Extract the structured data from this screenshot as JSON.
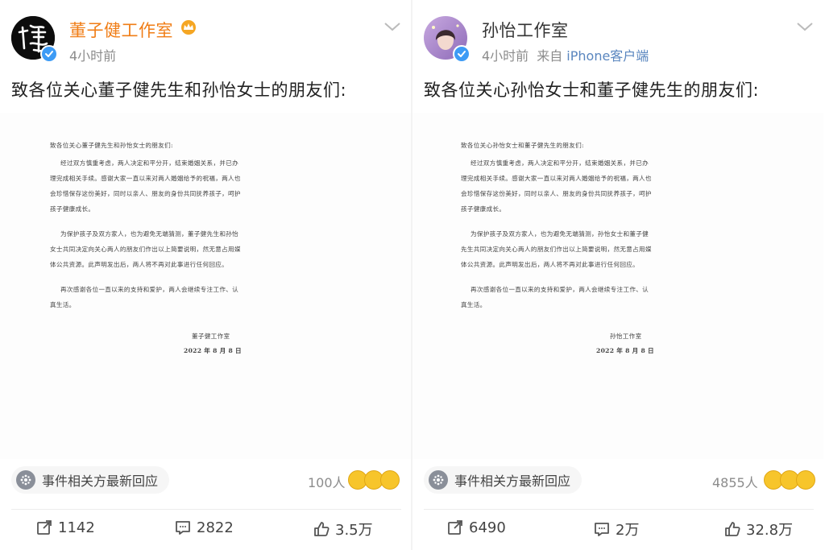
{
  "left": {
    "account_name": "董子健工作室",
    "time": "4小时前",
    "source_prefix": "",
    "source_device": "",
    "post_text": "致各位关心董子健先生和孙怡女士的朋友们:",
    "letter": {
      "greeting": "致各位关心董子健先生和孙怡女士的朋友们:",
      "p1": [
        "经过双方慎重考虑，两人决定和平分开，结束婚姻关系，并已办",
        "理完成相关手续。感谢大家一直以来对两人婚姻给予的祝福，两人也",
        "会珍惜保存这份美好，同时以亲人、朋友的身份共同抚养孩子，呵护",
        "孩子健康成长。"
      ],
      "p2": [
        "为保护孩子及双方家人，也为避免无端猜测，董子健先生和孙怡",
        "女士共同决定向关心两人的朋友们作出以上简要说明，然无意占用媒",
        "体公共资源。此声明发出后，两人将不再对此事进行任何回应。"
      ],
      "p3": [
        "再次感谢各位一直以来的支持和爱护，两人会继续专注工作、认",
        "真生活。"
      ],
      "signature": "董子健工作室",
      "date": "2022 年 8 月 8 日"
    },
    "event_label": "事件相关方最新回应",
    "reaction_count": "100人",
    "actions": {
      "repost": "1142",
      "comment": "2822",
      "like": "3.5万"
    }
  },
  "right": {
    "account_name": "孙怡工作室",
    "time": "4小时前",
    "source_prefix": "来自",
    "source_device": "iPhone客户端",
    "post_text": "致各位关心孙怡女士和董子健先生的朋友们:",
    "letter": {
      "greeting": "致各位关心孙怡女士和董子健先生的朋友们:",
      "p1": [
        "经过双方慎重考虑，两人决定和平分开，结束婚姻关系，并已办",
        "理完成相关手续。感谢大家一直以来对两人婚姻给予的祝福，两人也",
        "会珍惜保存这份美好，同时以亲人、朋友的身份共同抚养孩子，呵护",
        "孩子健康成长。"
      ],
      "p2": [
        "为保护孩子及双方家人，也为避免无端猜测，孙怡女士和董子健",
        "先生共同决定向关心两人的朋友们作出以上简要说明，然无意占用媒",
        "体公共资源。此声明发出后，两人将不再对此事进行任何回应。"
      ],
      "p3": [
        "再次感谢各位一直以来的支持和爱护，两人会继续专注工作、认",
        "真生活。"
      ],
      "signature": "孙怡工作室",
      "date": "2022 年 8 月 8 日"
    },
    "event_label": "事件相关方最新回应",
    "reaction_count": "4855人",
    "actions": {
      "repost": "6490",
      "comment": "2万",
      "like": "32.8万"
    }
  },
  "icons": {
    "verified": "verified-badge-icon",
    "crown": "vip-crown-icon",
    "more": "chevron-down-icon",
    "event": "event-icon",
    "repost": "repost-icon",
    "comment": "comment-icon",
    "like": "like-icon"
  },
  "colors": {
    "vip_name": "#f07d16",
    "verified": "#3d9bf5",
    "link": "#5a86bf",
    "muted": "#8c8c8c"
  }
}
